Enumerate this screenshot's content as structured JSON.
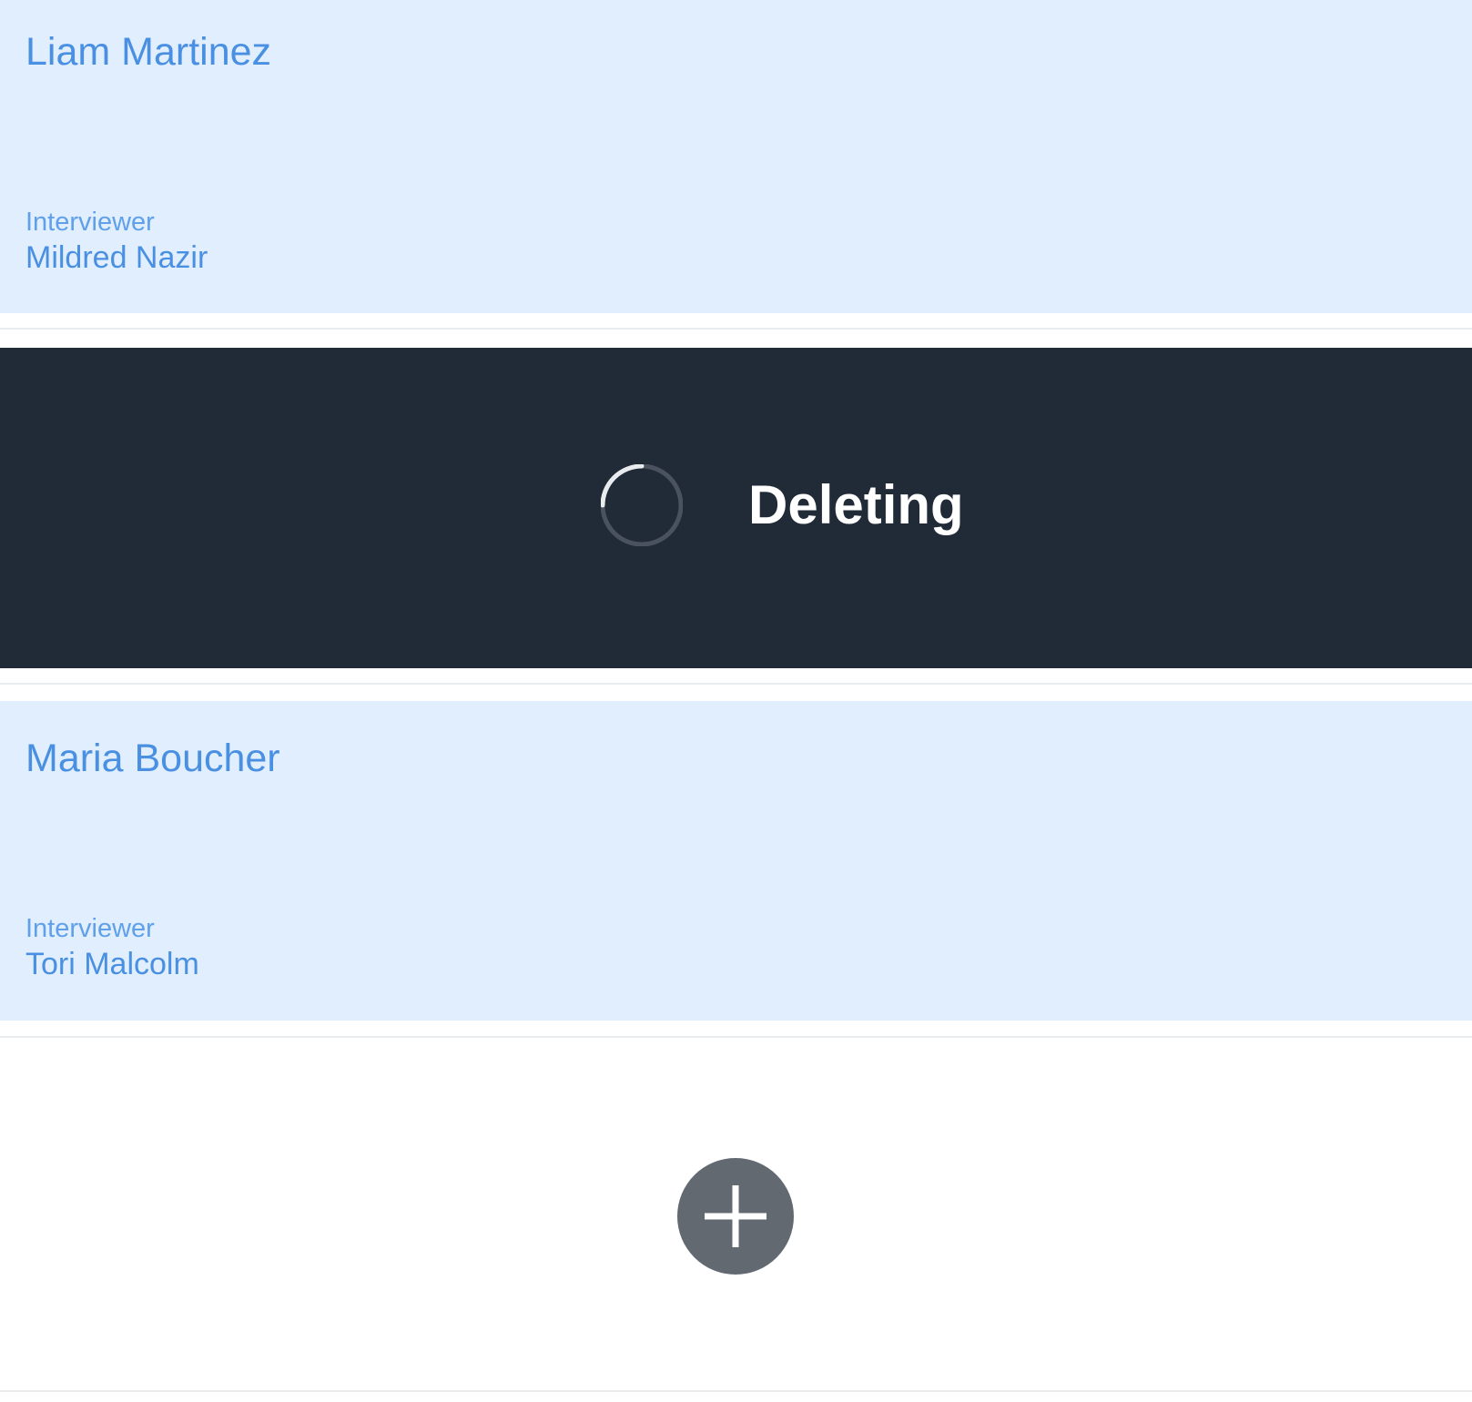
{
  "cards": [
    {
      "name": "Liam Martinez",
      "interviewer_label": "Interviewer",
      "interviewer_name": "Mildred Nazir"
    },
    {
      "name": "Maria Boucher",
      "interviewer_label": "Interviewer",
      "interviewer_name": "Tori Malcolm"
    }
  ],
  "deleting_row": {
    "status_text": "Deleting",
    "icon": "spinner-icon"
  },
  "add_button": {
    "icon": "plus-icon"
  },
  "colors": {
    "card_background": "#e1eefd",
    "accent_text": "#4a90e2",
    "deleting_background": "#212a37",
    "add_button_background": "#636971"
  }
}
